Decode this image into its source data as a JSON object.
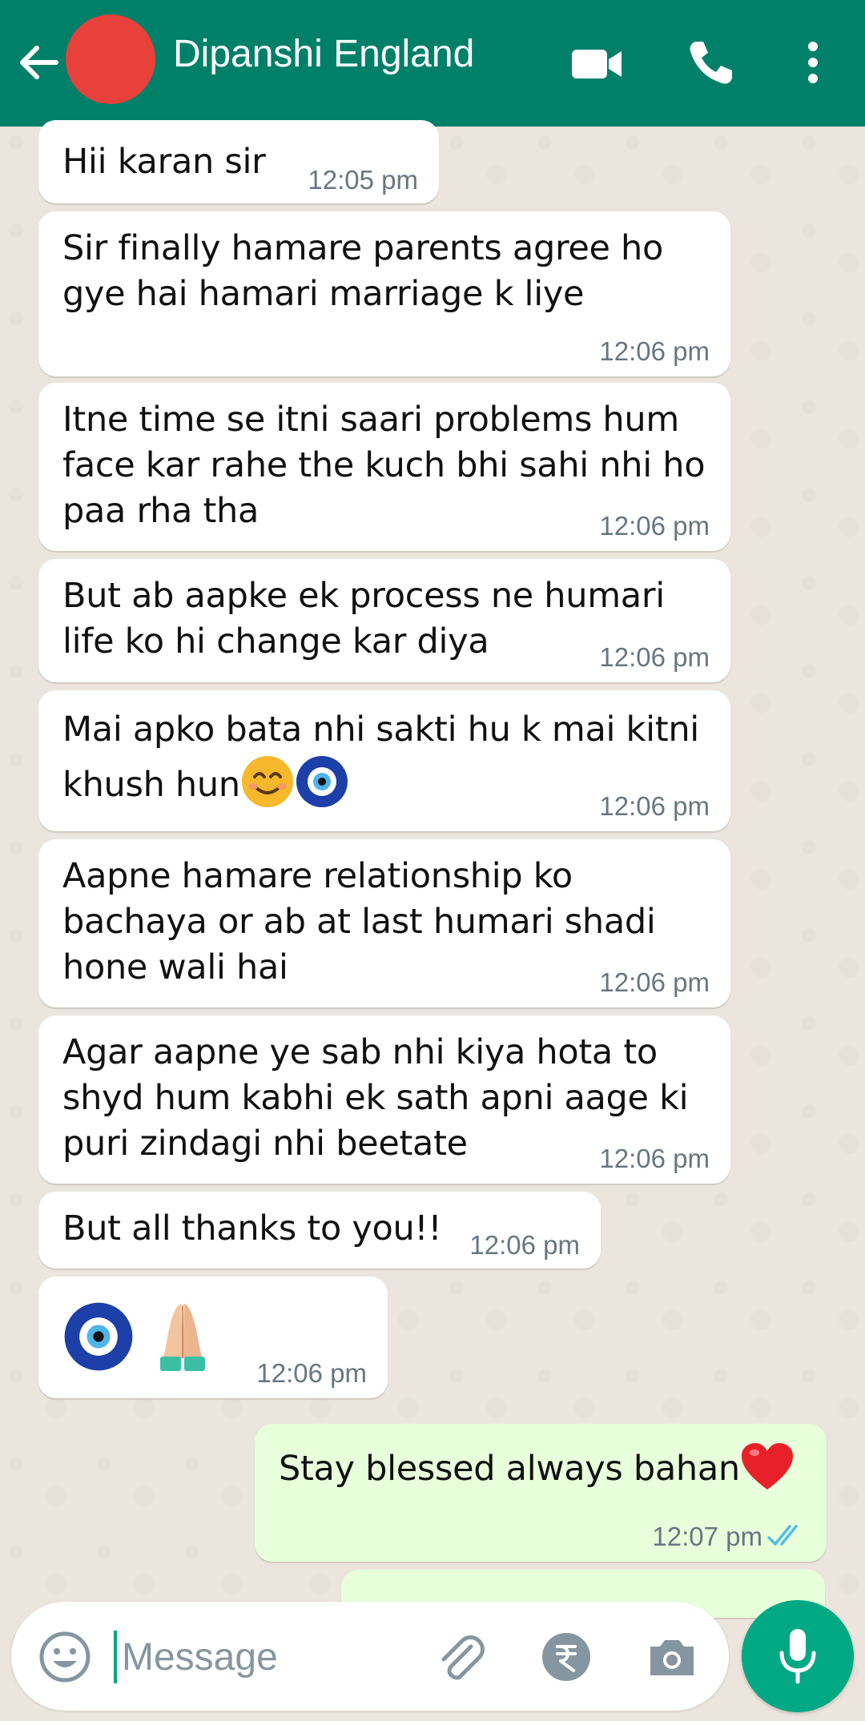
{
  "header": {
    "contact_name": "Dipanshi England",
    "icons": [
      "back-arrow-icon",
      "avatar",
      "video-call-icon",
      "phone-icon",
      "more-vert-icon"
    ]
  },
  "messages": [
    {
      "dir": "in",
      "text": "Hii karan sir",
      "time": "12:05 pm"
    },
    {
      "dir": "in",
      "text": "Sir finally hamare parents agree ho gye hai hamari marriage k liye",
      "time": "12:06 pm"
    },
    {
      "dir": "in",
      "text": "Itne time se itni saari problems hum face kar rahe the kuch bhi sahi nhi ho paa rha tha",
      "time": "12:06 pm"
    },
    {
      "dir": "in",
      "text": "But ab aapke ek process ne humari life ko hi change kar diya",
      "time": "12:06 pm"
    },
    {
      "dir": "in",
      "text": "Mai apko bata nhi sakti hu k mai kitni khush hun",
      "emojis": [
        "smiling-face-emoji",
        "nazar-amulet-emoji"
      ],
      "time": "12:06 pm"
    },
    {
      "dir": "in",
      "text": "Aapne hamare relationship ko bachaya or ab at last humari shadi hone wali hai",
      "time": "12:06 pm"
    },
    {
      "dir": "in",
      "text": "Agar aapne ye sab nhi kiya hota to shyd hum kabhi ek sath apni aage ki puri zindagi nhi beetate",
      "time": "12:06 pm"
    },
    {
      "dir": "in",
      "text": "But all thanks to you!!",
      "time": "12:06 pm"
    },
    {
      "dir": "in",
      "text": "",
      "emojis": [
        "nazar-amulet-emoji",
        "folded-hands-emoji"
      ],
      "time": "12:06 pm"
    },
    {
      "dir": "out",
      "text": "Stay blessed always bahan",
      "emojis": [
        "red-heart-emoji"
      ],
      "time": "12:07 pm",
      "status": "read"
    }
  ],
  "composer": {
    "placeholder": "Message",
    "icons": [
      "emoji-icon",
      "attach-icon",
      "rupee-payment-icon",
      "camera-icon",
      "mic-icon"
    ]
  },
  "colors": {
    "header": "#008069",
    "chat_bg": "#ece5dd",
    "incoming": "#ffffff",
    "outgoing": "#e7ffdb",
    "accent": "#00a884",
    "read_tick": "#53bdeb"
  }
}
